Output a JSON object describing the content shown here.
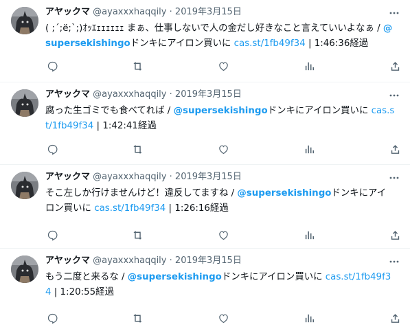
{
  "tweets": [
    {
      "name": "アヤックマ",
      "handle": "@ayaxxxhaqqily",
      "separator": "·",
      "date": "2019年3月15日",
      "text": "( ;´;ë;`;)ｵｯｴｪｪｪｪｪｪ まぁ、仕事しないで人の金だし好きなこと言えていいよなぁ / ",
      "mention": "@supersekishingo",
      "after_mention": "ドンキにアイロン買いに ",
      "link": "cas.st/1fb49f34",
      "meta": " | 1:46:36経過"
    },
    {
      "name": "アヤックマ",
      "handle": "@ayaxxxhaqqily",
      "separator": "·",
      "date": "2019年3月15日",
      "text": "腐った生ゴミでも食べてれば / ",
      "mention": "@supersekishingo",
      "after_mention": "ドンキにアイロン買いに ",
      "link": "cas.st/1fb49f34",
      "meta": " | 1:42:41経過"
    },
    {
      "name": "アヤックマ",
      "handle": "@ayaxxxhaqqily",
      "separator": "·",
      "date": "2019年3月15日",
      "text": "そこ左しか行けませんけど！違反してますね / ",
      "mention": "@supersekishingo",
      "after_mention": "ドンキにアイロン買いに ",
      "link": "cas.st/1fb49f34",
      "meta": " | 1:26:16経過"
    },
    {
      "name": "アヤックマ",
      "handle": "@ayaxxxhaqqily",
      "separator": "·",
      "date": "2019年3月15日",
      "text": "もう二度と来るな / ",
      "mention": "@supersekishingo",
      "after_mention": "ドンキにアイロン買いに ",
      "link": "cas.st/1fb49f34",
      "meta": " | 1:20:55経過"
    }
  ],
  "icons": {
    "reply": "reply-icon",
    "retweet": "retweet-icon",
    "like": "like-icon",
    "views": "views-icon",
    "share": "share-icon",
    "more": "more-icon"
  },
  "colors": {
    "text": "#0f1419",
    "secondary": "#536471",
    "link": "#1d9bf0",
    "divider": "#eff3f4"
  }
}
